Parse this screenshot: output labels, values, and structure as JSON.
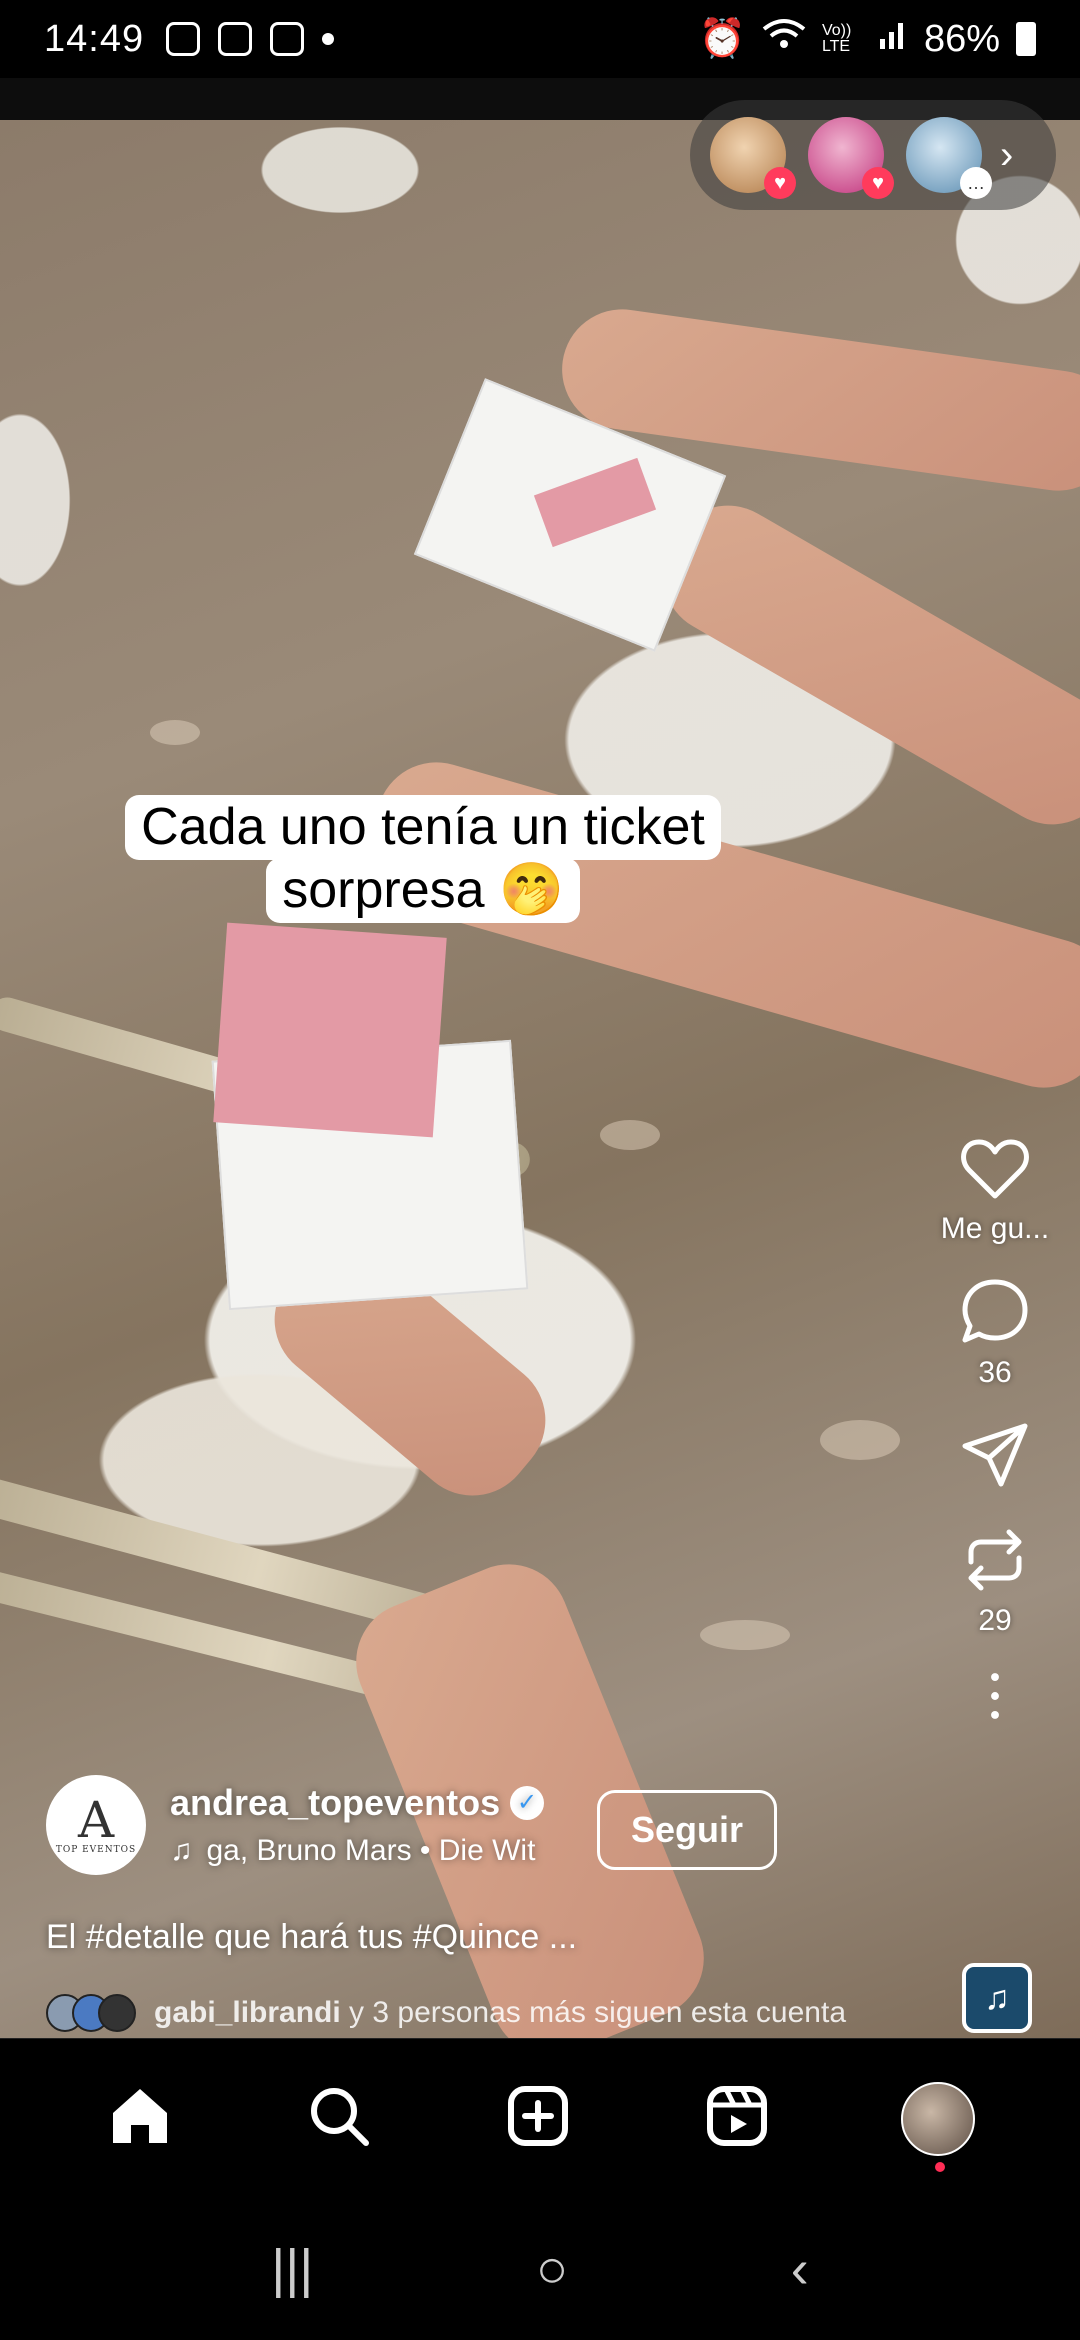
{
  "status_bar": {
    "time": "14:49",
    "battery": "86%",
    "network": "Vo)) LTE"
  },
  "post": {
    "caption_line1": "Cada uno tenía un ticket",
    "caption_line2": "sorpresa 🤭",
    "likes_label": "Me gu...",
    "comments_count": "36",
    "reposts_count": "29",
    "author": {
      "username": "andrea_topeventos",
      "logo_letter": "A",
      "logo_sub": "TOP EVENTOS",
      "music": "ga, Bruno Mars • Die Wit"
    },
    "follow_label": "Seguir",
    "description": "El #detalle que hará tus #Quince ...",
    "followers_text_user": "gabi_librandi",
    "followers_text_rest": " y 3 personas más siguen esta cuenta"
  },
  "stories": {
    "avatars": [
      {
        "name": "story-avatar-1",
        "color": "#d6a670",
        "badge": "♥"
      },
      {
        "name": "story-avatar-2",
        "color": "#d75a9e",
        "badge": "♥"
      },
      {
        "name": "story-avatar-3",
        "color": "#7ab0d8",
        "badge": "…"
      }
    ],
    "more": "›"
  },
  "icons": {
    "like": "heart-icon",
    "comment": "comment-icon",
    "share": "send-icon",
    "repost": "repost-icon",
    "more": "more-icon",
    "home": "home-icon",
    "search": "search-icon",
    "create": "add-icon",
    "reels": "reels-icon"
  },
  "system_nav": {
    "recents": "|||",
    "home": "○",
    "back": "‹"
  }
}
